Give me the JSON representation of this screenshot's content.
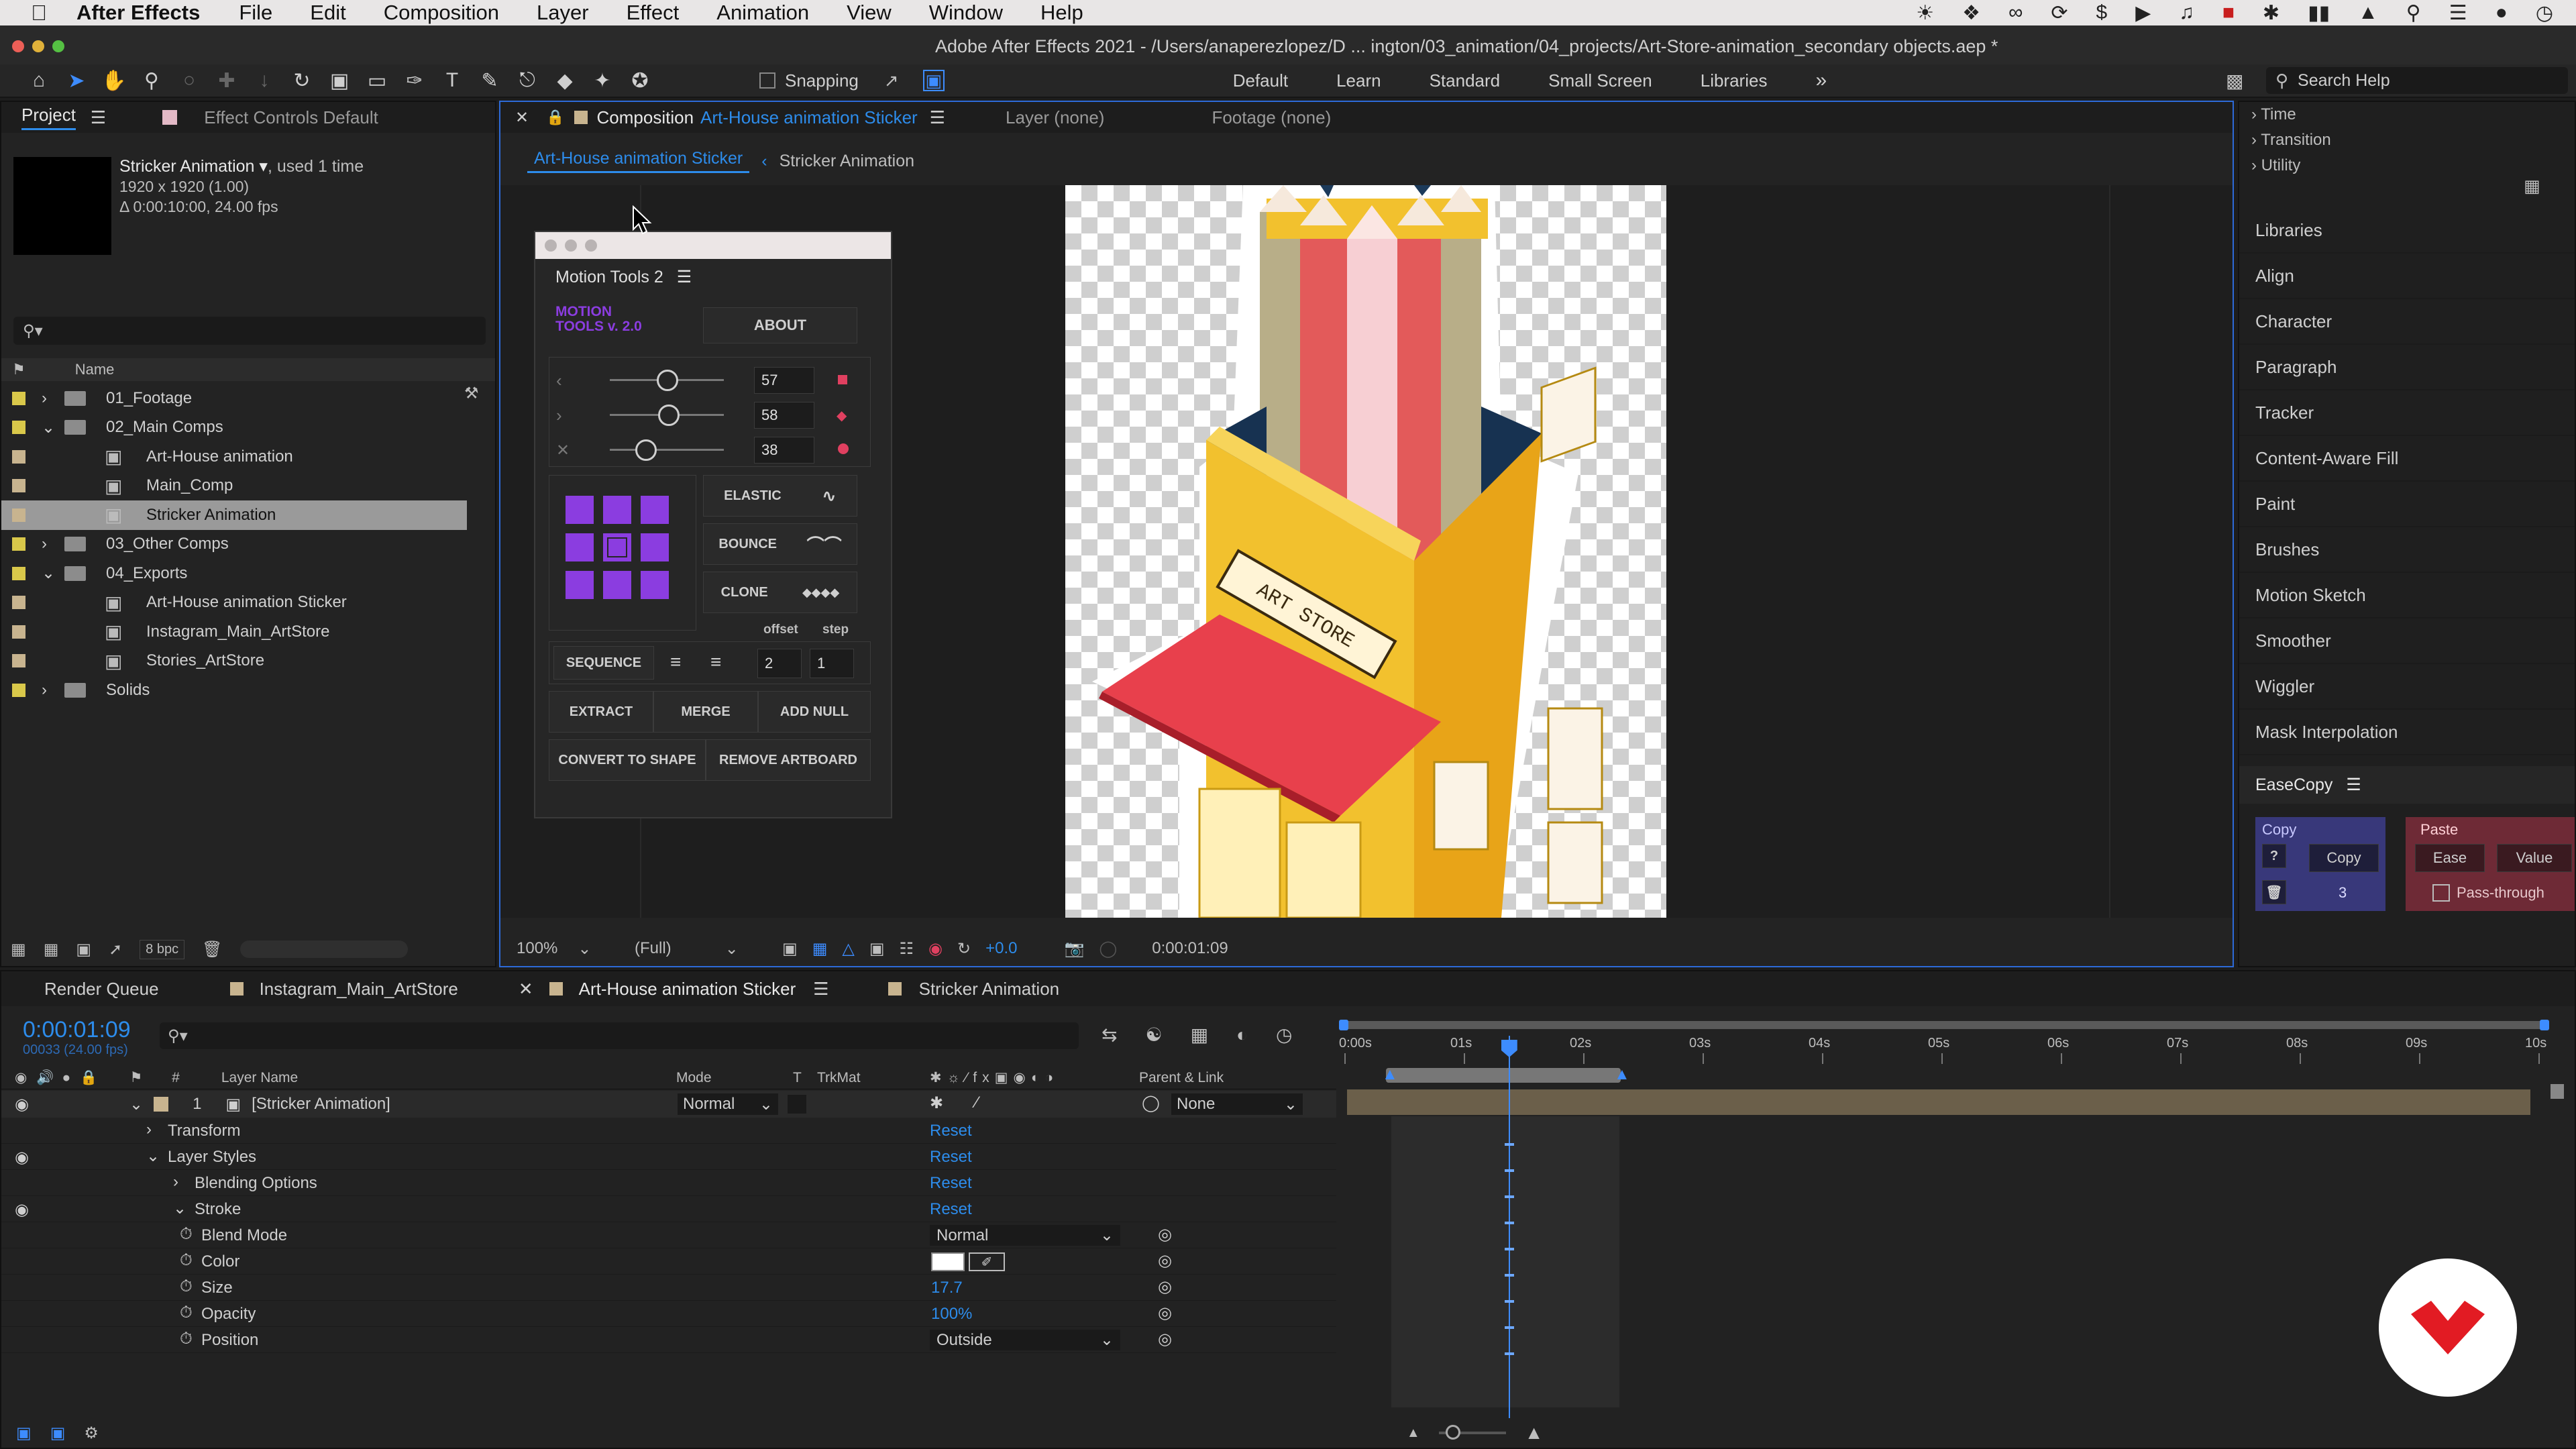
{
  "menubar": {
    "app": "After Effects",
    "items": [
      "File",
      "Edit",
      "Composition",
      "Layer",
      "Effect",
      "Animation",
      "View",
      "Window",
      "Help"
    ]
  },
  "window": {
    "title": "Adobe After Effects 2021 - /Users/anaperezlopez/D ... ington/03_animation/04_projects/Art-Store-animation_secondary objects.aep *"
  },
  "toolbar": {
    "snapping": "Snapping",
    "workspaces": [
      "Default",
      "Learn",
      "Standard",
      "Small Screen",
      "Libraries"
    ],
    "search_placeholder": "Search Help"
  },
  "project": {
    "tab": "Project",
    "effect_tab": "Effect Controls Default",
    "selected_name": "Stricker Animation ▾",
    "used": ", used 1 time",
    "dims": "1920 x 1920 (1.00)",
    "duration": "Δ 0:00:10:00, 24.00 fps",
    "col_name": "Name",
    "bpc": "8 bpc",
    "items": [
      {
        "label": "01_Footage",
        "type": "folder",
        "indent": 0,
        "open": false,
        "color": "#d9c84a"
      },
      {
        "label": "02_Main Comps",
        "type": "folder",
        "indent": 0,
        "open": true,
        "color": "#d9c84a"
      },
      {
        "label": "Art-House animation",
        "type": "comp",
        "indent": 1,
        "color": "#c8b48f"
      },
      {
        "label": "Main_Comp",
        "type": "comp",
        "indent": 1,
        "color": "#c8b48f"
      },
      {
        "label": "Stricker Animation",
        "type": "comp",
        "indent": 1,
        "color": "#c8b48f",
        "selected": true
      },
      {
        "label": "03_Other Comps",
        "type": "folder",
        "indent": 0,
        "open": false,
        "color": "#d9c84a"
      },
      {
        "label": "04_Exports",
        "type": "folder",
        "indent": 0,
        "open": true,
        "color": "#d9c84a"
      },
      {
        "label": "Art-House animation Sticker",
        "type": "comp",
        "indent": 1,
        "color": "#c8b48f"
      },
      {
        "label": "Instagram_Main_ArtStore",
        "type": "comp",
        "indent": 1,
        "color": "#c8b48f"
      },
      {
        "label": "Stories_ArtStore",
        "type": "comp",
        "indent": 1,
        "color": "#c8b48f"
      },
      {
        "label": "Solids",
        "type": "folder",
        "indent": 0,
        "open": false,
        "color": "#d9c84a"
      }
    ]
  },
  "comp": {
    "tab_prefix": "Composition",
    "tab_name": "Art-House animation Sticker",
    "layer_tab": "Layer (none)",
    "footage_tab": "Footage (none)",
    "crumb1": "Art-House animation Sticker",
    "crumb2": "Stricker Animation",
    "zoom": "100%",
    "quality": "(Full)",
    "exposure": "+0.0",
    "timecode": "0:00:01:09",
    "sign_text": "ART STORE"
  },
  "motion_tools": {
    "title": "Motion Tools 2",
    "logo_line1": "MOTION",
    "logo_line2": "TOOLS v. 2.0",
    "about": "ABOUT",
    "slider_values": [
      "57",
      "58",
      "38"
    ],
    "elastic": "ELASTIC",
    "bounce": "BOUNCE",
    "clone": "CLONE",
    "offset": "offset",
    "step": "step",
    "sequence": "SEQUENCE",
    "seq_offset": "2",
    "seq_step": "1",
    "extract": "EXTRACT",
    "merge": "MERGE",
    "add_null": "ADD NULL",
    "convert": "CONVERT TO SHAPE",
    "remove_artboard": "REMOVE ARTBOARD"
  },
  "right_panel": {
    "tree": [
      "Time",
      "Transition",
      "Utility"
    ],
    "items": [
      "Libraries",
      "Align",
      "Character",
      "Paragraph",
      "Tracker",
      "Content-Aware Fill",
      "Paint",
      "Brushes",
      "Motion Sketch",
      "Smoother",
      "Wiggler",
      "Mask Interpolation"
    ],
    "easecopy": {
      "title": "EaseCopy",
      "copy_label": "Copy",
      "copy_btn": "Copy",
      "q": "?",
      "num": "3",
      "paste_label": "Paste",
      "ease": "Ease",
      "value": "Value",
      "pass": "Pass-through"
    }
  },
  "timeline": {
    "tabs": [
      "Render Queue",
      "Instagram_Main_ArtStore",
      "Art-House animation Sticker",
      "Stricker Animation"
    ],
    "timecode": "0:00:01:09",
    "frames": "00033 (24.00 fps)",
    "headers": {
      "num": "#",
      "layer": "Layer Name",
      "mode": "Mode",
      "t": "T",
      "trkmat": "TrkMat",
      "parent": "Parent & Link"
    },
    "layer": {
      "num": "1",
      "name": "[Stricker Animation]",
      "mode": "Normal",
      "parent": "None"
    },
    "props": [
      {
        "label": "Transform",
        "level": 1,
        "twirl": "right",
        "value": "Reset",
        "eye": false
      },
      {
        "label": "Layer Styles",
        "level": 1,
        "twirl": "down",
        "value": "Reset",
        "eye": true
      },
      {
        "label": "Blending Options",
        "level": 2,
        "twirl": "right",
        "value": "Reset",
        "eye": false
      },
      {
        "label": "Stroke",
        "level": 2,
        "twirl": "down",
        "value": "Reset",
        "eye": true
      },
      {
        "label": "Blend Mode",
        "level": 3,
        "value": "Normal",
        "kind": "dropdown"
      },
      {
        "label": "Color",
        "level": 3,
        "value": "",
        "kind": "color"
      },
      {
        "label": "Size",
        "level": 3,
        "value": "17.7",
        "kind": "num"
      },
      {
        "label": "Opacity",
        "level": 3,
        "value": "100%",
        "kind": "num"
      },
      {
        "label": "Position",
        "level": 3,
        "value": "Outside",
        "kind": "dropdown"
      }
    ],
    "ruler": [
      "0:00s",
      "01s",
      "02s",
      "03s",
      "04s",
      "05s",
      "06s",
      "07s",
      "08s",
      "09s",
      "10s"
    ],
    "playhead_sec": 1.375
  }
}
